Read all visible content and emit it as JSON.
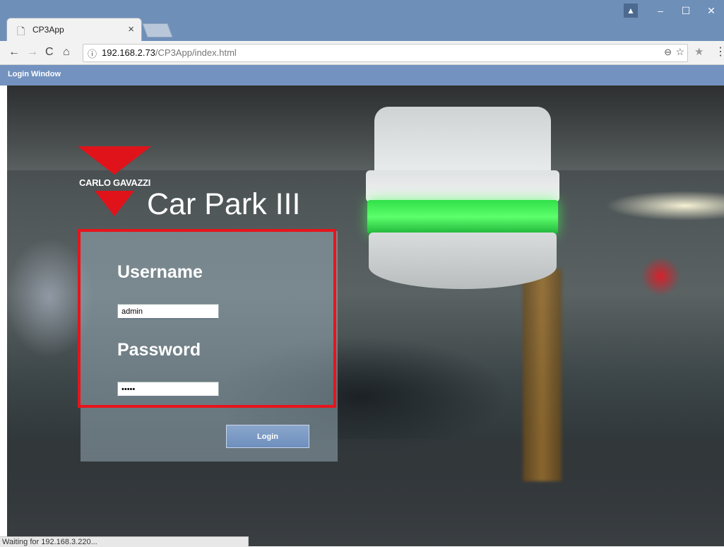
{
  "browser": {
    "tab_title": "CP3App",
    "tab_close": "×",
    "url_host": "192.168.2.73",
    "url_path": "/CP3App/index.html",
    "status_text": "Waiting for 192.168.3.220...",
    "icons": [
      "page-icon",
      "back-icon",
      "forward-icon",
      "reload-icon",
      "home-icon",
      "info-icon",
      "zoom-icon",
      "bookmark-star-icon",
      "extension-star-icon",
      "menu-icon",
      "profile-icon",
      "minimize-icon",
      "maximize-icon",
      "close-icon"
    ]
  },
  "app": {
    "header_title": "Login Window",
    "brand_name": "CARLO GAVAZZI",
    "product_title": "Car Park III",
    "username_label": "Username",
    "username_value": "admin",
    "password_label": "Password",
    "password_value": "•••••",
    "login_button": "Login",
    "colors": {
      "header": "#7392bf",
      "brand_red": "#e0131b",
      "highlight": "#e8141b",
      "button": "#6e8fbd"
    }
  }
}
